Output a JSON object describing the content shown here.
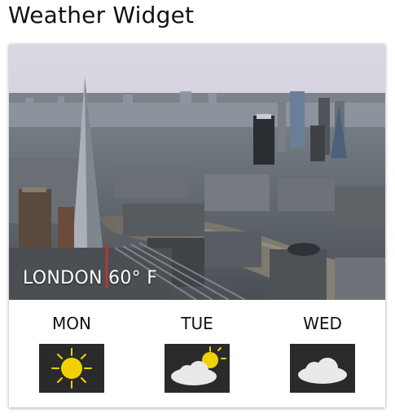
{
  "page": {
    "title": "Weather Widget"
  },
  "hero": {
    "caption": "LONDON 60° F",
    "image": "london-skyline-photo"
  },
  "forecast": [
    {
      "day": "MON",
      "icon": "sunny-icon"
    },
    {
      "day": "TUE",
      "icon": "partly-cloudy-icon"
    },
    {
      "day": "WED",
      "icon": "cloudy-icon"
    }
  ],
  "colors": {
    "sun": "#f2d100",
    "cloud": "#e9e9e9",
    "icon_bg": "#2a2a2a"
  }
}
